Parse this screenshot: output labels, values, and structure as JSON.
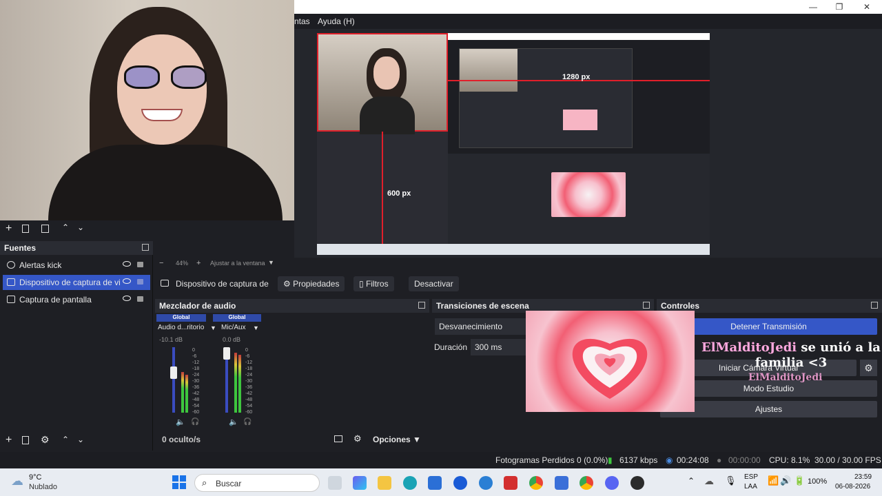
{
  "menu": {
    "item1": "ntas",
    "item2": "Ayuda (H)"
  },
  "window_controls": {
    "minimize": "—",
    "maximize": "❐",
    "close": "✕"
  },
  "canvas_labels": {
    "width_label": "1280 px",
    "height_label": "600 px"
  },
  "zoom": {
    "minus": "−",
    "value": "44%",
    "plus": "+",
    "fit": "Ajustar a la ventana"
  },
  "sources_panel": {
    "title": "Fuentes",
    "items": [
      {
        "label": "Alertas kick"
      },
      {
        "label": "Dispositivo de captura de video"
      },
      {
        "label": "Captura de pantalla"
      }
    ]
  },
  "source_toolbar": {
    "selected": "Dispositivo de captura de v",
    "properties": "Propiedades",
    "filters": "Filtros",
    "deactivate": "Desactivar"
  },
  "mixer": {
    "title": "Mezclador de audio",
    "channels": [
      {
        "tag": "Global",
        "name": "Audio d...ritorio",
        "db": "-10.1 dB",
        "level": 0.62
      },
      {
        "tag": "Global",
        "name": "Mic/Aux",
        "db": "0.0 dB",
        "level": 0.92
      }
    ],
    "scale": [
      "0",
      "-6",
      "-12",
      "-18",
      "-24",
      "-30",
      "-36",
      "-42",
      "-48",
      "-54",
      "-60"
    ],
    "hidden": "0 oculto/s",
    "options": "Opciones"
  },
  "transitions": {
    "title": "Transiciones de escena",
    "type": "Desvanecimiento",
    "duration_label": "Duración",
    "duration_value": "300 ms"
  },
  "controls": {
    "title": "Controles",
    "stop_stream": "Detener Transmisión",
    "virtual_cam": "Iniciar Cámara Virtual",
    "studio_mode": "Modo Estudio",
    "settings": "Ajustes"
  },
  "alert": {
    "username": "ElMalditoJedi",
    "message": "se unió a la familia <3",
    "username2": "ElMalditoJedi"
  },
  "status": {
    "dropped": "Fotogramas Perdidos 0 (0.0%)",
    "kbps": "6137 kbps",
    "live_time": "00:24:08",
    "rec_time": "00:00:00",
    "cpu": "CPU: 8.1%",
    "fps": "30.00 / 30.00 FPS"
  },
  "taskbar": {
    "weather_temp": "9°C",
    "weather_desc": "Nublado",
    "search": "Buscar",
    "lang1": "ESP",
    "lang2": "LAA",
    "battery": "100%",
    "time": "23:59",
    "date": "06-08-2026"
  },
  "colors": {
    "accent": "#3557c7",
    "red_outline": "#e11f2a",
    "panel_bg": "#1e1f24"
  }
}
